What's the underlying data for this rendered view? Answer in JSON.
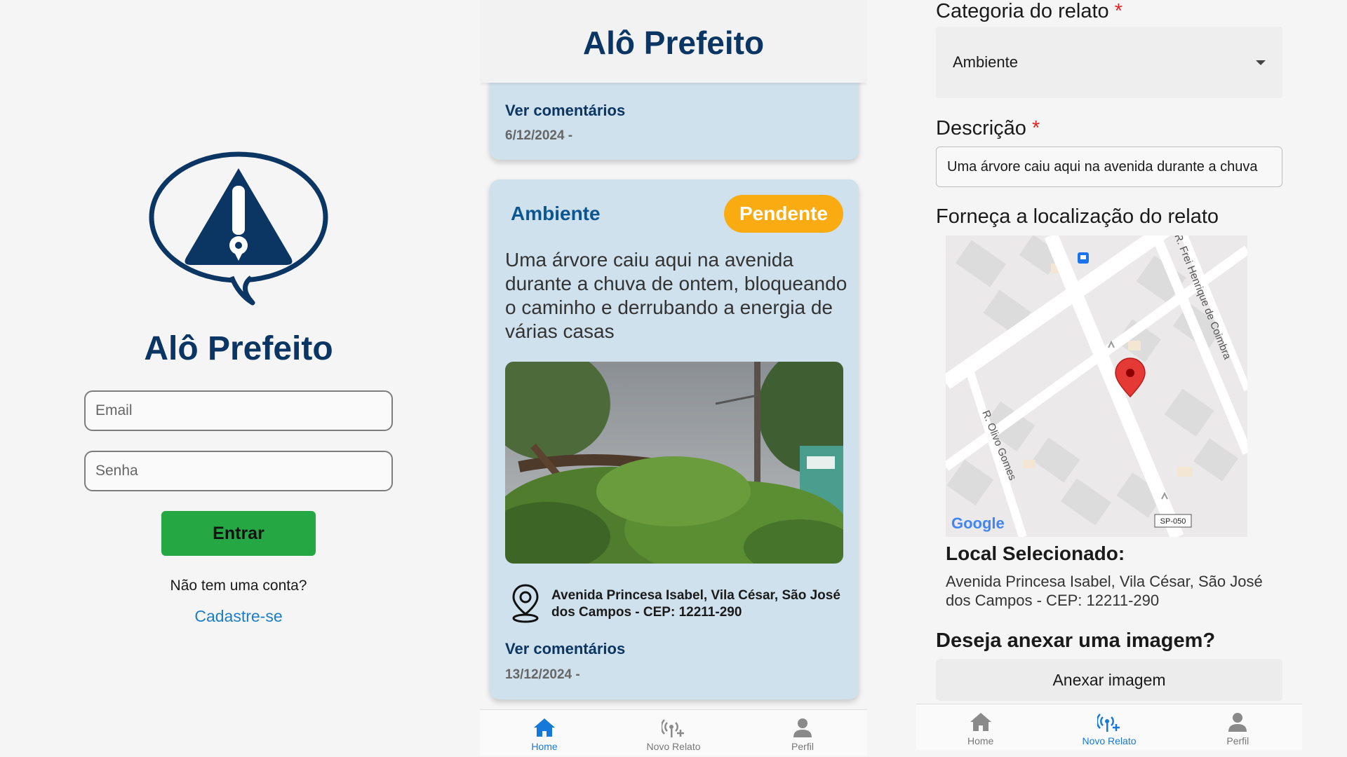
{
  "login": {
    "app_title": "Alô Prefeito",
    "email_placeholder": "Email",
    "password_placeholder": "Senha",
    "login_button": "Entrar",
    "no_account_text": "Não tem uma conta?",
    "signup_link": "Cadastre-se"
  },
  "home": {
    "header_title": "Alô Prefeito",
    "reports": [
      {
        "comments_link": "Ver comentários",
        "date": "6/12/2024 -"
      },
      {
        "category": "Ambiente",
        "status": "Pendente",
        "description": "Uma árvore caiu aqui na avenida durante a chuva de ontem, bloqueando o caminho e derrubando a energia de várias casas",
        "address": "Avenida Princesa Isabel, Vila César, São José dos Campos - CEP: 12211-290",
        "comments_link": "Ver comentários",
        "date": "13/12/2024 -"
      }
    ],
    "nav": [
      {
        "label": "Home",
        "icon": "home-icon",
        "active": true
      },
      {
        "label": "Novo Relato",
        "icon": "broadcast-add-icon",
        "active": false
      },
      {
        "label": "Perfil",
        "icon": "person-icon",
        "active": false
      }
    ]
  },
  "new_report": {
    "category_label": "Categoria do relato",
    "required_mark": "*",
    "category_value": "Ambiente",
    "description_label": "Descrição",
    "description_value": "Uma árvore caiu aqui na avenida durante a chuva",
    "location_label": "Forneça a localização do relato",
    "map": {
      "street_1": "R. Frei Henrique de Coimbra",
      "street_2": "R. Olivo Gomes",
      "road_badge": "SP-050",
      "provider": "Google"
    },
    "selected_title": "Local Selecionado:",
    "selected_address": "Avenida Princesa Isabel, Vila César, São José dos Campos - CEP: 12211-290",
    "attach_question": "Deseja anexar uma imagem?",
    "attach_button": "Anexar imagem",
    "nav": [
      {
        "label": "Home",
        "icon": "home-icon",
        "active": false
      },
      {
        "label": "Novo Relato",
        "icon": "broadcast-add-icon",
        "active": true
      },
      {
        "label": "Perfil",
        "icon": "person-icon",
        "active": false
      }
    ]
  },
  "colors": {
    "brand_navy": "#0b3664",
    "button_green": "#25a744",
    "badge_orange": "#fbab12",
    "card_blue": "#cfe1ec",
    "nav_active": "#1579d9",
    "required_red": "#e02424",
    "pin_red": "#e53935"
  }
}
